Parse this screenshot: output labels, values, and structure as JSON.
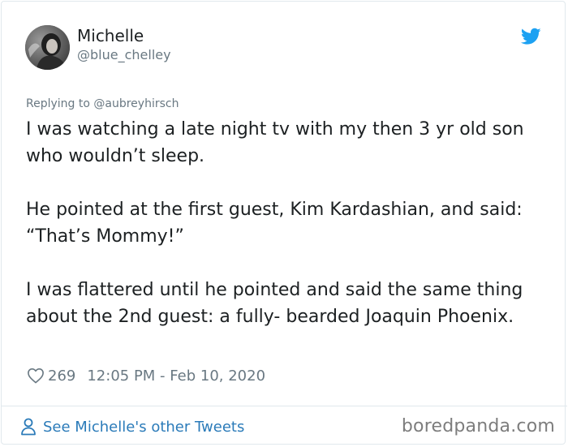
{
  "author": {
    "display_name": "Michelle",
    "handle": "@blue_chelley",
    "avatar_icon": "profile-photo"
  },
  "tweet": {
    "reply_prefix": "Replying to ",
    "reply_to": "@aubreyhirsch",
    "paragraphs": [
      "I was watching a late night tv with my then 3 yr old son who wouldn’t sleep.",
      "He pointed at the first guest, Kim Kardashian, and said: “That’s Mommy!”",
      "I was flattered until he pointed and said the same thing about the 2nd guest: a fully- bearded Joaquin Phoenix."
    ],
    "likes": "269",
    "timestamp": "12:05 PM - Feb 10, 2020"
  },
  "footer": {
    "see_more": "See Michelle's other Tweets",
    "watermark": "boredpanda.com"
  },
  "colors": {
    "twitter_blue": "#1da1f2",
    "link_blue": "#2b7bb9",
    "secondary_text": "#697882",
    "primary_text": "#1c2022",
    "border": "#e1e8ed"
  }
}
